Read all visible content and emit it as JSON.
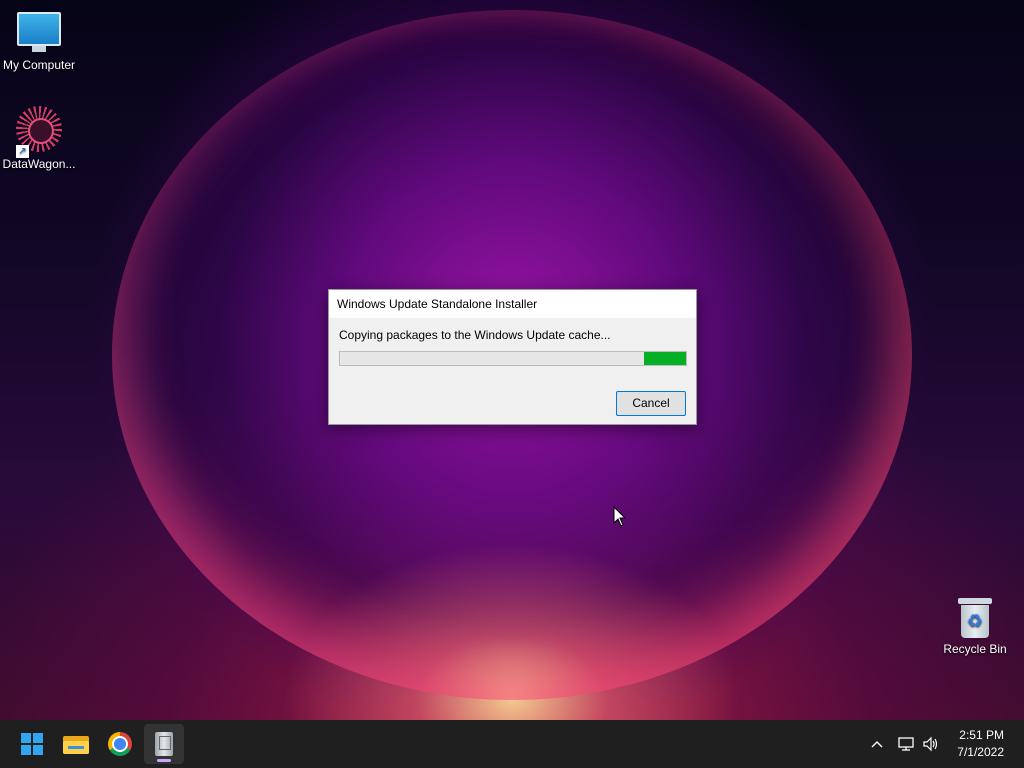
{
  "desktop": {
    "icons": [
      {
        "label": "My Computer",
        "icon": "monitor-icon"
      },
      {
        "label": "DataWagon...",
        "icon": "datawagon-icon"
      },
      {
        "label": "Recycle Bin",
        "icon": "recycle-bin-icon"
      }
    ]
  },
  "dialog": {
    "title": "Windows Update Standalone Installer",
    "message": "Copying packages to the Windows Update cache...",
    "progress_state": "indeterminate-marquee",
    "cancel_label": "Cancel"
  },
  "taskbar": {
    "apps": [
      {
        "name": "start",
        "icon": "windows-start-icon"
      },
      {
        "name": "file-explorer",
        "icon": "folder-icon"
      },
      {
        "name": "chrome",
        "icon": "chrome-icon"
      },
      {
        "name": "installer",
        "icon": "installer-icon",
        "active": true
      }
    ],
    "tray": {
      "chevron": "^",
      "network_icon": "network-icon",
      "volume_icon": "volume-icon"
    },
    "clock": {
      "time": "2:51 PM",
      "date": "7/1/2022"
    }
  },
  "colors": {
    "progress_fill": "#06b025",
    "accent": "#0078d7",
    "taskbar": "#1f1f1f"
  }
}
